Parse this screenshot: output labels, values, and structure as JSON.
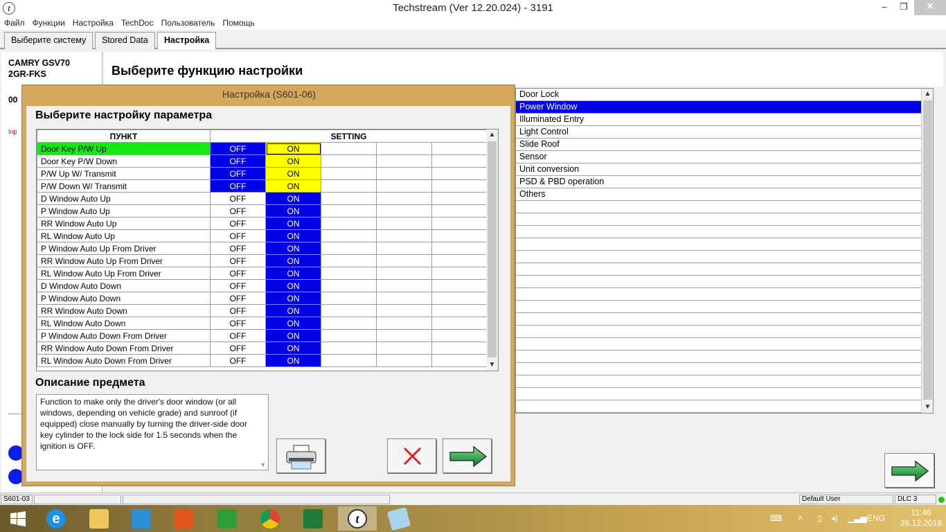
{
  "window": {
    "title": "Techstream (Ver 12.20.024) - 3191",
    "app_icon": "t",
    "minimize": "–",
    "maximize": "❐",
    "close": "✕"
  },
  "menu": [
    "Файл",
    "Функции",
    "Настройка",
    "TechDoc",
    "Пользователь",
    "Помощь"
  ],
  "tabs": [
    {
      "label": "Выберите систему",
      "active": false
    },
    {
      "label": "Stored Data",
      "active": false
    },
    {
      "label": "Настройка",
      "active": true
    }
  ],
  "vehicle": {
    "model": "CAMRY GSV70",
    "engine": "2GR-FKS",
    "code_fragment": "00",
    "red_fragment": "Inp"
  },
  "page_title": "Выберите функцию настройки",
  "function_list": {
    "items": [
      "Door Lock",
      "Power Window",
      "Illuminated Entry",
      "Light Control",
      "Slide Roof",
      "Sensor",
      "Unit conversion",
      "PSD & PBD operation",
      "Others"
    ],
    "selected_index": 1,
    "empty_rows": 17
  },
  "dialog": {
    "title": "Настройка (S601-06)",
    "heading": "Выберите настройку параметра",
    "column_item": "ПУНКТ",
    "column_setting": "SETTING",
    "rows": [
      {
        "item": "Door Key P/W Up",
        "off": "OFF",
        "on": "ON",
        "state": "yellow",
        "current": true
      },
      {
        "item": "Door Key P/W Down",
        "off": "OFF",
        "on": "ON",
        "state": "yellow",
        "current": false
      },
      {
        "item": "P/W Up W/ Transmit",
        "off": "OFF",
        "on": "ON",
        "state": "yellow",
        "current": false
      },
      {
        "item": "P/W Down W/ Transmit",
        "off": "OFF",
        "on": "ON",
        "state": "yellow",
        "current": false
      },
      {
        "item": "D Window Auto Up",
        "off": "OFF",
        "on": "ON",
        "state": "blue",
        "current": false
      },
      {
        "item": "P Window Auto Up",
        "off": "OFF",
        "on": "ON",
        "state": "blue",
        "current": false
      },
      {
        "item": "RR Window Auto Up",
        "off": "OFF",
        "on": "ON",
        "state": "blue",
        "current": false
      },
      {
        "item": "RL Window Auto Up",
        "off": "OFF",
        "on": "ON",
        "state": "blue",
        "current": false
      },
      {
        "item": "P Window Auto Up From Driver",
        "off": "OFF",
        "on": "ON",
        "state": "blue",
        "current": false
      },
      {
        "item": "RR Window Auto Up From Driver",
        "off": "OFF",
        "on": "ON",
        "state": "blue",
        "current": false
      },
      {
        "item": "RL Window Auto Up From Driver",
        "off": "OFF",
        "on": "ON",
        "state": "blue",
        "current": false
      },
      {
        "item": "D Window Auto Down",
        "off": "OFF",
        "on": "ON",
        "state": "blue",
        "current": false
      },
      {
        "item": "P Window Auto Down",
        "off": "OFF",
        "on": "ON",
        "state": "blue",
        "current": false
      },
      {
        "item": "RR Window Auto Down",
        "off": "OFF",
        "on": "ON",
        "state": "blue",
        "current": false
      },
      {
        "item": "RL Window Auto Down",
        "off": "OFF",
        "on": "ON",
        "state": "blue",
        "current": false
      },
      {
        "item": "P Window Auto Down From Driver",
        "off": "OFF",
        "on": "ON",
        "state": "blue",
        "current": false
      },
      {
        "item": "RR Window Auto Down From Driver",
        "off": "OFF",
        "on": "ON",
        "state": "blue",
        "current": false
      },
      {
        "item": "RL Window Auto Down From Driver",
        "off": "OFF",
        "on": "ON",
        "state": "blue",
        "current": false
      }
    ],
    "desc_heading": "Описание предмета",
    "description": "Function to make only the driver's door window (or all windows, depending on vehicle grade) and sunroof (if equipped) close manually by turning the driver-side door key cylinder to the lock side for 1.5 seconds when the ignition is OFF."
  },
  "colors": {
    "selected_blue": "#0000e8",
    "on_blue": "#0202e4",
    "highlight_yellow": "#ffff00",
    "current_green": "#17e617",
    "dialog_frame": "#d6a85e"
  },
  "statusbar": {
    "code": "S601-03",
    "user": "Default User",
    "dlc": "DLC 3"
  },
  "taskbar": {
    "icons": [
      "start-icon",
      "ie-icon",
      "explorer-icon",
      "touch-icon",
      "photos-icon",
      "store-icon",
      "chrome-icon",
      "paint-icon",
      "techstream-icon",
      "app-icon"
    ],
    "language": "ENG",
    "time": "11:46",
    "date": "26.12.2018"
  }
}
